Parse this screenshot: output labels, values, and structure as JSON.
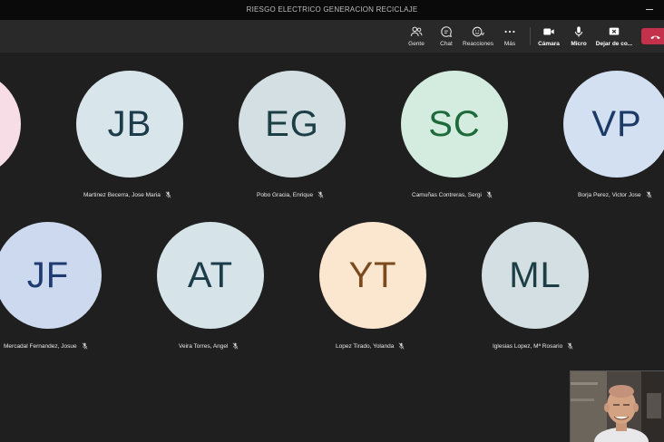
{
  "window": {
    "title": "RIESGO ELECTRICO GENERACION RECICLAJE"
  },
  "toolbar": {
    "people_label": "Gente",
    "chat_label": "Chat",
    "reactions_label": "Reacciones",
    "more_label": "Más",
    "camera_label": "Cámara",
    "mic_label": "Micro",
    "leave_label": "Dejar de co..."
  },
  "participants": [
    {
      "initials": "",
      "name": "...",
      "bg": "#f6dde6",
      "fg": "#8a3b55"
    },
    {
      "initials": "JB",
      "name": "Martinez Becerra, Jose Maria",
      "bg": "#d8e6ec",
      "fg": "#1d3c4a"
    },
    {
      "initials": "EG",
      "name": "Pobo Gracia, Enrique",
      "bg": "#d3dfe3",
      "fg": "#1c3f45"
    },
    {
      "initials": "SC",
      "name": "Camuñas Contreras, Sergi",
      "bg": "#d3ecdf",
      "fg": "#1e6a3b"
    },
    {
      "initials": "VP",
      "name": "Borja Perez, Victor Jose",
      "bg": "#d3e0f1",
      "fg": "#1c3a66"
    },
    {
      "initials": "JF",
      "name": "Mercadal Fernandez, Josue",
      "bg": "#ccd9ef",
      "fg": "#1f3c72"
    },
    {
      "initials": "AT",
      "name": "Veira Torres, Angel",
      "bg": "#d6e4ea",
      "fg": "#1c3c49"
    },
    {
      "initials": "YT",
      "name": "Lopez Tirado, Yolanda",
      "bg": "#fbe6d0",
      "fg": "#7a4a1d"
    },
    {
      "initials": "ML",
      "name": "Iglesias Lopez, Mª Rosario",
      "bg": "#d3dfe3",
      "fg": "#1c3f45"
    }
  ],
  "colors": {
    "leave": "#c4314b",
    "background": "#1f1f1f",
    "toolbar": "#292929"
  }
}
